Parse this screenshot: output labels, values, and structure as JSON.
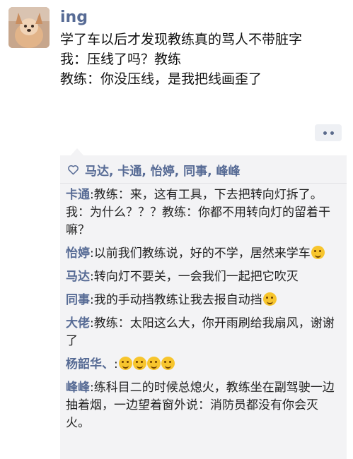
{
  "post": {
    "author": "ing",
    "lines": [
      "学了车以后才发现教练真的骂人不带脏字",
      "我：压线了吗？教练",
      "教练：你没压线，是我把线画歪了"
    ]
  },
  "likes": {
    "names": "马达, 卡通, 怡婷, 同事, 峰峰"
  },
  "comments": [
    {
      "name": "卡通",
      "sep": ":",
      "text": "教练：来，这有工具，下去把转向灯拆了。我：为什么？？？教练：你都不用转向灯的留着干嘛？",
      "emoji_count": 0
    },
    {
      "name": "怡婷",
      "sep": ":",
      "text": "以前我们教练说，好的不学，居然来学车",
      "emoji_count": 1
    },
    {
      "name": "马达",
      "sep": ":",
      "text": "转向灯不要关，一会我们一起把它吹灭",
      "emoji_count": 0
    },
    {
      "name": "同事",
      "sep": ":",
      "text": "我的手动挡教练让我去报自动挡",
      "emoji_count": 1
    },
    {
      "name": "大佬",
      "sep": ":",
      "text": "教练：太阳这么大，你开雨刷给我扇风，谢谢了",
      "emoji_count": 0
    },
    {
      "name": "杨韶华、",
      "sep": ":",
      "text": "",
      "emoji_count": 4
    },
    {
      "name": "峰峰",
      "sep": ":",
      "text": "练科目二的时候总熄火，教练坐在副驾驶一边抽着烟，一边望着窗外说：消防员都没有你会灭火。",
      "emoji_count": 0
    }
  ],
  "icons": {
    "avatar": "dog-photo-avatar",
    "like": "heart-outline-icon",
    "more": "more-dots-icon",
    "emoji": "laughing-face-emoji"
  },
  "colors": {
    "name_link": "#576b95",
    "panel_bg": "#f3f3f5",
    "text": "#222222"
  }
}
